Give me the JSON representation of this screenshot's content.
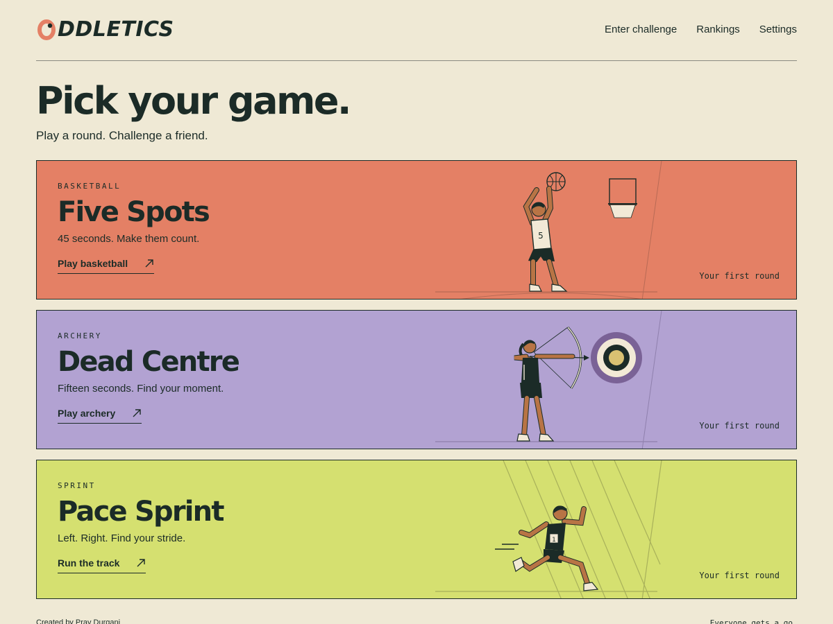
{
  "app": {
    "logo_text": "DDLETICS",
    "logo_letter": "O"
  },
  "nav": {
    "items": [
      "Enter challenge",
      "Rankings",
      "Settings"
    ]
  },
  "hero": {
    "title": "Pick your game.",
    "subtitle": "Play a round. Challenge a friend."
  },
  "cards": [
    {
      "kicker": "BASKETBALL",
      "title": "Five Spots",
      "description": "45 seconds. Make them count.",
      "cta": "Play basketball",
      "status": "Your first round",
      "bg": "#e48065",
      "jersey_number": "5"
    },
    {
      "kicker": "ARCHERY",
      "title": "Dead Centre",
      "description": "Fifteen seconds. Find your moment.",
      "cta": "Play archery",
      "status": "Your first round",
      "bg": "#b2a2d2"
    },
    {
      "kicker": "SPRINT",
      "title": "Pace Sprint",
      "description": "Left. Right. Find your stride.",
      "cta": "Run the track",
      "status": "Your first round",
      "bg": "#d5e070",
      "bib_number": "1"
    }
  ],
  "footer": {
    "credit": "Created by Prav Durgani",
    "tagline": "Everyone gets a go"
  },
  "icons": {
    "cta": "arrow-up-right-icon"
  },
  "colors": {
    "background": "#efe9d5",
    "ink": "#1b2b27",
    "accent": "#e48065"
  }
}
